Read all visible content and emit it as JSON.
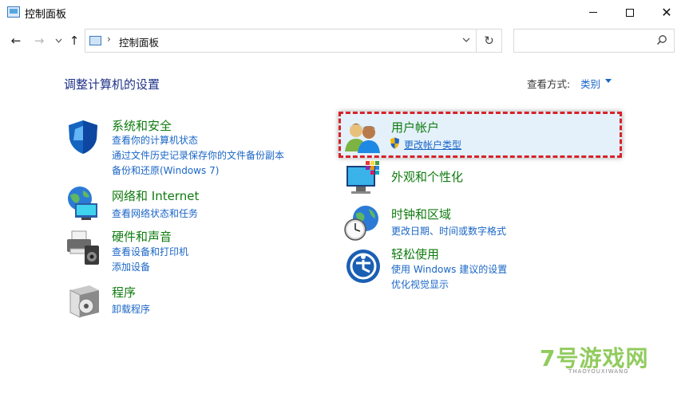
{
  "window": {
    "title": "控制面板",
    "minimize_glyph": "—",
    "maximize_glyph": "☐",
    "close_glyph": "✕"
  },
  "navigation": {
    "back_glyph": "←",
    "forward_glyph": "→",
    "recent_glyph": "⌄",
    "up_glyph": "↑",
    "address_separator": "›",
    "address_text": "控制面板",
    "address_dropdown_glyph": "⌄",
    "refresh_glyph": "↻",
    "search_placeholder": "",
    "search_glyph": "⚲"
  },
  "header": {
    "title": "调整计算机的设置",
    "view_by_label": "查看方式:",
    "view_by_value": "类别"
  },
  "categories_left": [
    {
      "title": "系统和安全",
      "icon": "shield-icon",
      "links": [
        "查看你的计算机状态",
        "通过文件历史记录保存你的文件备份副本",
        "备份和还原(Windows 7)"
      ]
    },
    {
      "title": "网络和 Internet",
      "icon": "network-globe-icon",
      "links": [
        "查看网络状态和任务"
      ]
    },
    {
      "title": "硬件和声音",
      "icon": "printer-speaker-icon",
      "links": [
        "查看设备和打印机",
        "添加设备"
      ]
    },
    {
      "title": "程序",
      "icon": "programs-disc-icon",
      "links": [
        "卸载程序"
      ]
    }
  ],
  "categories_right": [
    {
      "title": "用户帐户",
      "icon": "users-icon",
      "links": [
        "更改帐户类型"
      ]
    },
    {
      "title": "外观和个性化",
      "icon": "monitor-palette-icon",
      "links": []
    },
    {
      "title": "时钟和区域",
      "icon": "clock-globe-icon",
      "links": [
        "更改日期、时间或数字格式"
      ]
    },
    {
      "title": "轻松使用",
      "icon": "ease-of-access-icon",
      "links": [
        "使用 Windows 建议的设置",
        "优化视觉显示"
      ]
    }
  ],
  "watermark": {
    "text": "7号游戏网",
    "subtext": "THAOYOUXIWANG"
  },
  "colors": {
    "category_title": "#0f7b0f",
    "link": "#1a66c7",
    "heading": "#1e3287",
    "highlight_border": "#d6232a",
    "highlight_fill": "#e4f1fb"
  }
}
